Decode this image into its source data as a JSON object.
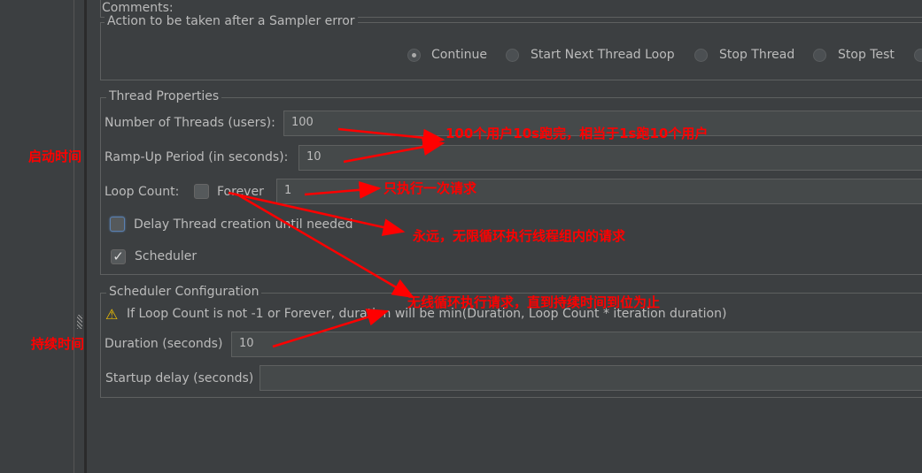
{
  "comments_label": "Comments:",
  "sampler_error": {
    "legend": "Action to be taken after a Sampler error",
    "options": [
      "Continue",
      "Start Next Thread Loop",
      "Stop Thread",
      "Stop Test"
    ],
    "selected": "Continue"
  },
  "thread_properties": {
    "legend": "Thread Properties",
    "threads_label": "Number of Threads (users):",
    "threads_value": "100",
    "rampup_label": "Ramp-Up Period (in seconds):",
    "rampup_value": "10",
    "loop_label": "Loop Count:",
    "forever_label": "Forever",
    "forever_checked": false,
    "loop_value": "1",
    "delay_label": "Delay Thread creation until needed",
    "delay_checked": false,
    "scheduler_label": "Scheduler",
    "scheduler_checked": true
  },
  "scheduler_config": {
    "legend": "Scheduler Configuration",
    "warning": "If Loop Count is not -1 or Forever, duration will be min(Duration, Loop Count * iteration duration)",
    "duration_label": "Duration (seconds)",
    "duration_value": "10",
    "startup_label": "Startup delay (seconds)",
    "startup_value": ""
  },
  "annotations": {
    "rampup_side": "启动时间",
    "duration_side": "持续时间",
    "threads_note": "100个用户10s跑完，相当于1s跑10个用户",
    "loop_note": "只执行一次请求",
    "forever_note": "永远，无限循环执行线程组内的请求",
    "scheduler_note": "无线循环执行请求，直到持续时间到位为止",
    "color": "#ff0000"
  }
}
